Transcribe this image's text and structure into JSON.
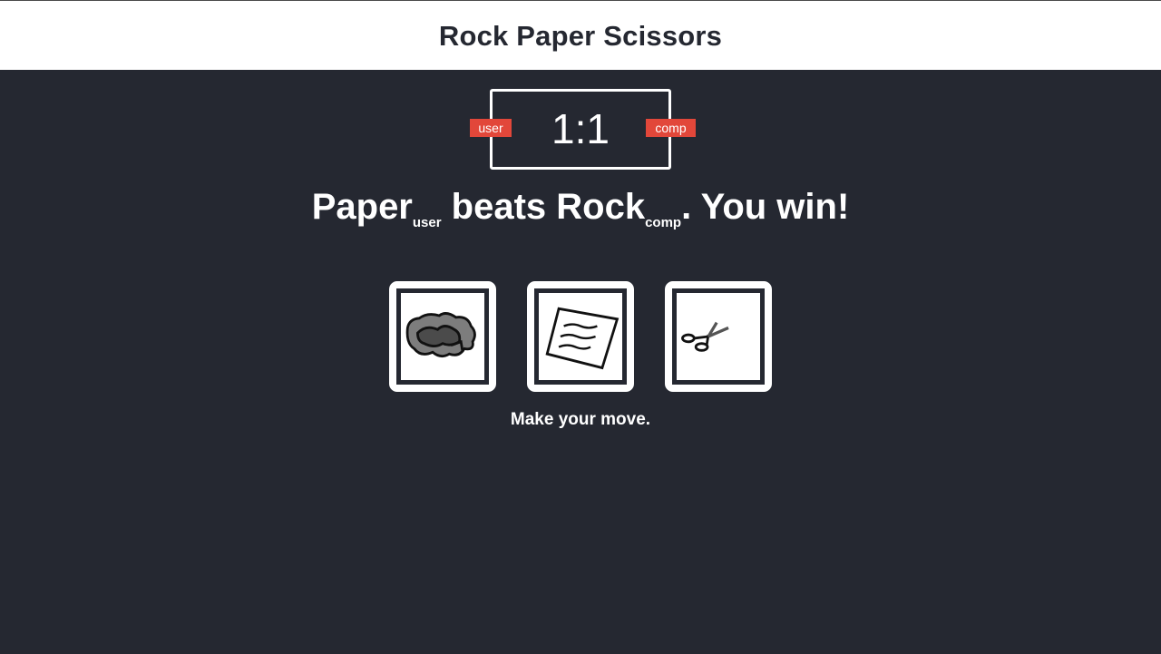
{
  "header": {
    "title": "Rock Paper Scissors"
  },
  "scoreboard": {
    "score": "1:1",
    "user_label": "user",
    "comp_label": "comp"
  },
  "result": {
    "user_choice": "Paper",
    "user_sub": "user",
    "verb": " beats ",
    "comp_choice": "Rock",
    "comp_sub": "comp",
    "outcome": ". You win!"
  },
  "choices": [
    {
      "name": "rock",
      "icon": "rock-icon"
    },
    {
      "name": "paper",
      "icon": "paper-icon"
    },
    {
      "name": "scissors",
      "icon": "scissors-icon"
    }
  ],
  "prompt": "Make your move.",
  "colors": {
    "background": "#252831",
    "header_bg": "#ffffff",
    "badge": "#e2473a",
    "text": "#ffffff"
  }
}
